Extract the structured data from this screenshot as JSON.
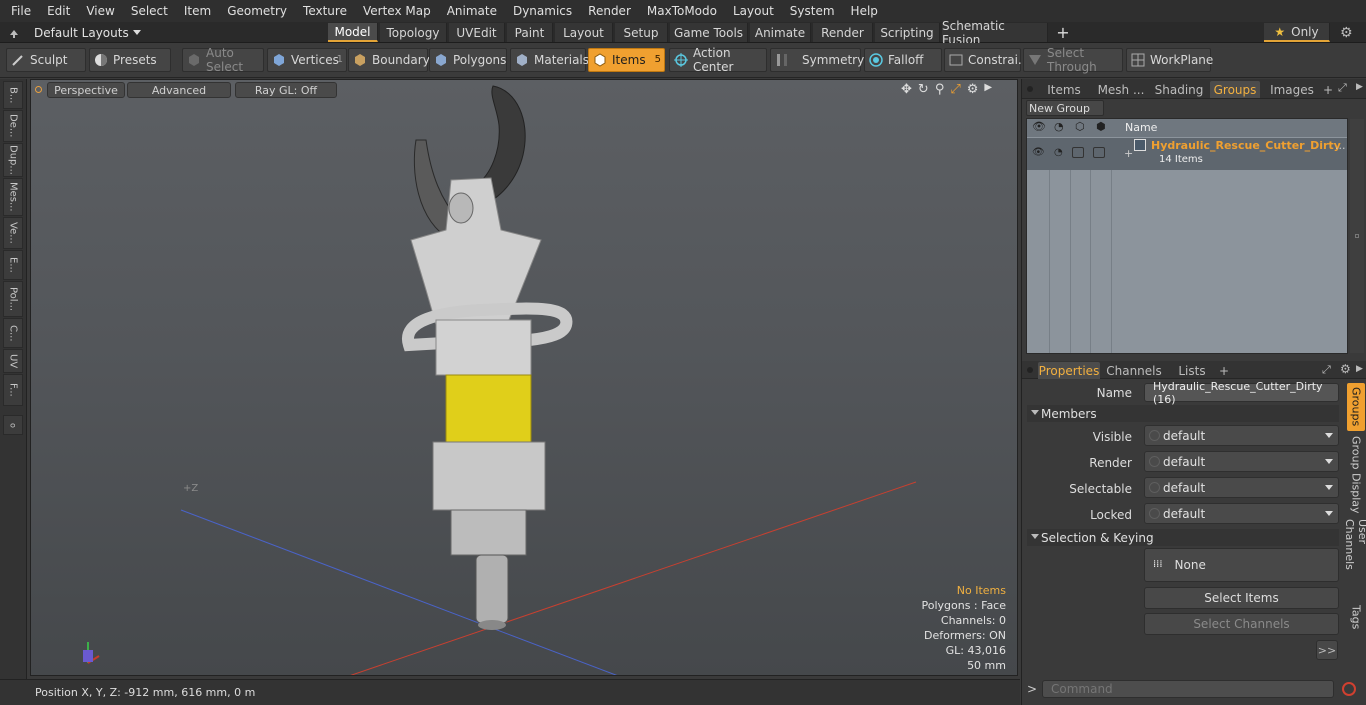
{
  "menu": [
    "File",
    "Edit",
    "View",
    "Select",
    "Item",
    "Geometry",
    "Texture",
    "Vertex Map",
    "Animate",
    "Dynamics",
    "Render",
    "MaxToModo",
    "Layout",
    "System",
    "Help"
  ],
  "layouts_label": "Default Layouts",
  "mode_tabs": [
    "Model",
    "Topology",
    "UVEdit",
    "Paint",
    "Layout",
    "Setup",
    "Game Tools",
    "Animate",
    "Render",
    "Scripting",
    "Schematic Fusion"
  ],
  "mode_active": "Model",
  "only_label": "Only",
  "toolbar": {
    "sculpt": "Sculpt",
    "presets": "Presets",
    "auto_select": "Auto Select",
    "vertices": "Vertices",
    "vertices_count": "1",
    "boundary": "Boundary",
    "polygons": "Polygons",
    "materials": "Materials",
    "items": "Items",
    "items_count": "5",
    "action_center": "Action Center",
    "symmetry": "Symmetry",
    "falloff": "Falloff",
    "constraints": "Constrai...",
    "select_through": "Select Through",
    "workplane": "WorkPlane"
  },
  "left_tabs": [
    "B...",
    "De...",
    "Dup...",
    "Mes...",
    "Ve...",
    "E...",
    "Pol...",
    "C...",
    "UV",
    "F..."
  ],
  "viewport": {
    "view_mode": "Perspective",
    "shading": "Advanced",
    "raygl": "Ray GL: Off",
    "stats": {
      "no_items": "No Items",
      "polygons": "Polygons : Face",
      "channels": "Channels: 0",
      "deformers": "Deformers: ON",
      "gl": "GL: 43,016",
      "scale": "50 mm"
    },
    "axis_label": "+Z"
  },
  "status": {
    "position": "Position X, Y, Z:  -912 mm, 616 mm, 0 m"
  },
  "groups_panel": {
    "tabs": [
      "Items",
      "Mesh ...",
      "Shading",
      "Groups",
      "Images"
    ],
    "active_tab": "Groups",
    "new_group": "New Group",
    "col_name": "Name",
    "group_name": "Hydraulic_Rescue_Cutter_Dirty",
    "group_count": "14 Items"
  },
  "properties_panel": {
    "tabs": [
      "Properties",
      "Channels",
      "Lists"
    ],
    "active_tab": "Properties",
    "name_label": "Name",
    "name_value": "Hydraulic_Rescue_Cutter_Dirty (16)",
    "members_header": "Members",
    "rows": [
      {
        "label": "Visible",
        "value": "default"
      },
      {
        "label": "Render",
        "value": "default"
      },
      {
        "label": "Selectable",
        "value": "default"
      },
      {
        "label": "Locked",
        "value": "default"
      }
    ],
    "selection_header": "Selection & Keying",
    "none_label": "None",
    "select_items": "Select Items",
    "select_channels": "Select Channels",
    "more": ">>",
    "side_tabs": [
      "Groups",
      "Group Display",
      "User Channels",
      "Tags"
    ]
  },
  "command": {
    "prompt": ">",
    "placeholder": "Command"
  },
  "colors": {
    "accent": "#f0a030",
    "active_text": "#f2b040",
    "viewport_bg": "#55585c"
  }
}
